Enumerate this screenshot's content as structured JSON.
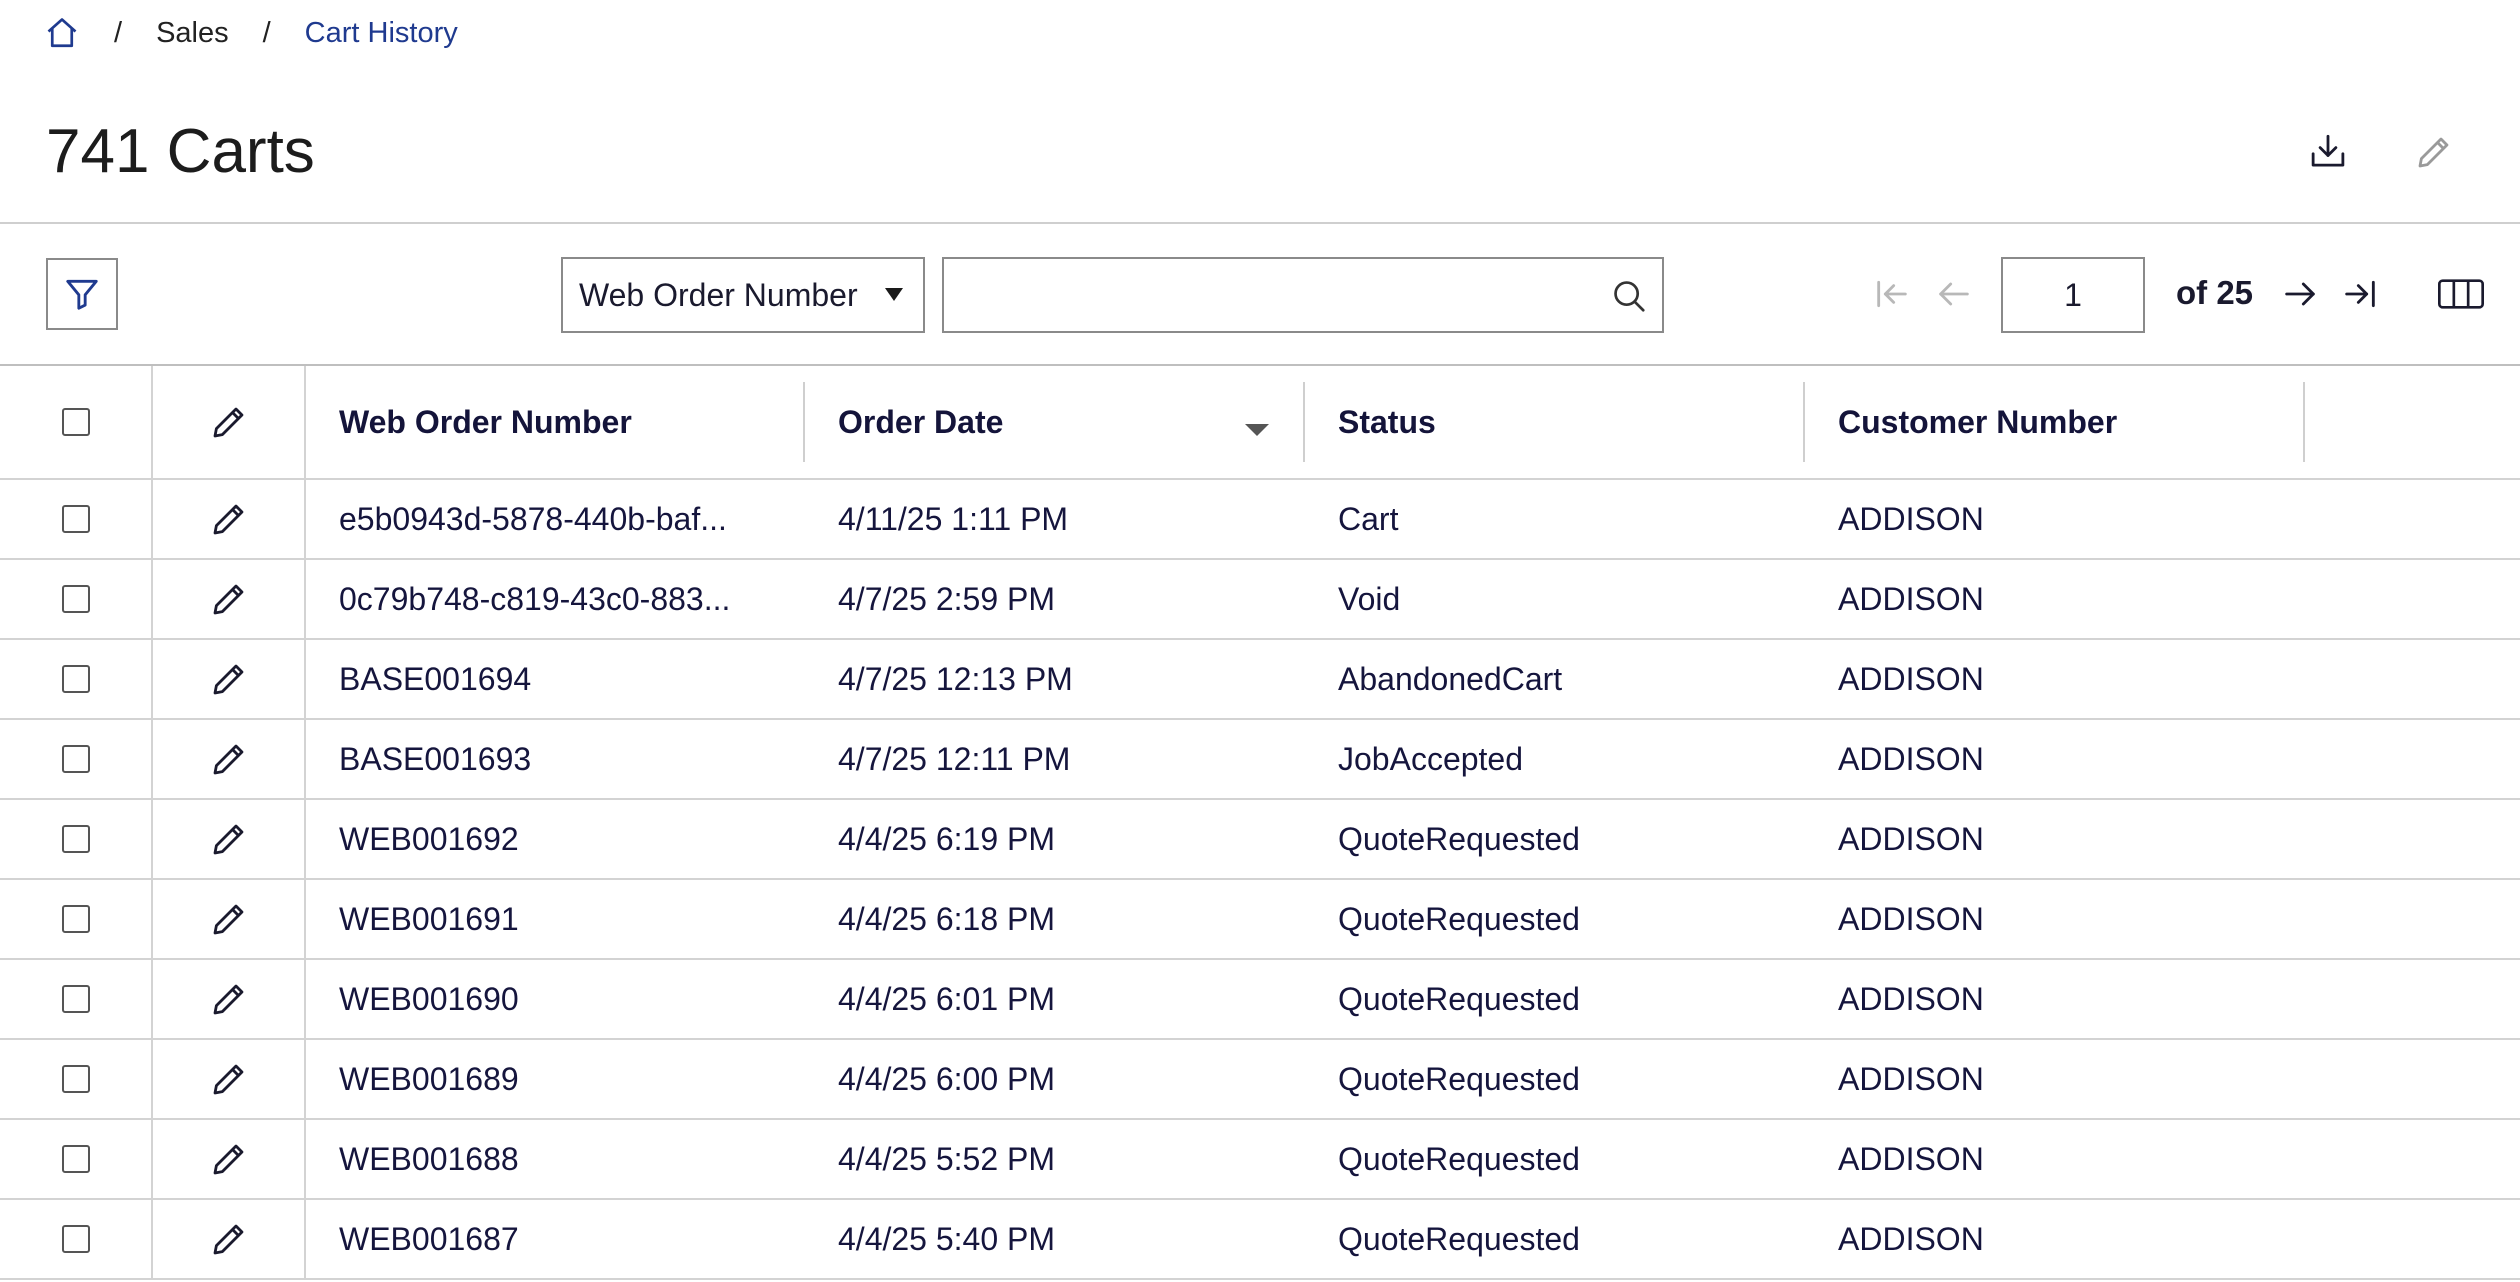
{
  "breadcrumb": {
    "home_icon": "home-icon",
    "separator": "/",
    "items": [
      {
        "label": "Sales"
      },
      {
        "label": "Cart History"
      }
    ]
  },
  "page": {
    "title": "741 Carts"
  },
  "header_actions": {
    "download_icon": "download-icon",
    "edit_icon": "edit-icon"
  },
  "toolbar": {
    "filter_icon": "filter-icon",
    "search_field_selected": "Web Order Number",
    "search_value": "",
    "search_icon": "search-icon",
    "pagination": {
      "current_page": "1",
      "of_label": "of",
      "total_pages": "25"
    }
  },
  "table": {
    "columns": [
      "Web Order Number",
      "Order Date",
      "Status",
      "Customer Number"
    ],
    "sort_column": "Order Date",
    "sort_direction": "descending",
    "rows": [
      {
        "web_order_number": "e5b0943d-5878-440b-baf...",
        "order_date": "4/11/25 1:11 PM",
        "status": "Cart",
        "customer_number": "ADDISON"
      },
      {
        "web_order_number": "0c79b748-c819-43c0-883...",
        "order_date": "4/7/25 2:59 PM",
        "status": "Void",
        "customer_number": "ADDISON"
      },
      {
        "web_order_number": "BASE001694",
        "order_date": "4/7/25 12:13 PM",
        "status": "AbandonedCart",
        "customer_number": "ADDISON"
      },
      {
        "web_order_number": "BASE001693",
        "order_date": "4/7/25 12:11 PM",
        "status": "JobAccepted",
        "customer_number": "ADDISON"
      },
      {
        "web_order_number": "WEB001692",
        "order_date": "4/4/25 6:19 PM",
        "status": "QuoteRequested",
        "customer_number": "ADDISON"
      },
      {
        "web_order_number": "WEB001691",
        "order_date": "4/4/25 6:18 PM",
        "status": "QuoteRequested",
        "customer_number": "ADDISON"
      },
      {
        "web_order_number": "WEB001690",
        "order_date": "4/4/25 6:01 PM",
        "status": "QuoteRequested",
        "customer_number": "ADDISON"
      },
      {
        "web_order_number": "WEB001689",
        "order_date": "4/4/25 6:00 PM",
        "status": "QuoteRequested",
        "customer_number": "ADDISON"
      },
      {
        "web_order_number": "WEB001688",
        "order_date": "4/4/25 5:52 PM",
        "status": "QuoteRequested",
        "customer_number": "ADDISON"
      },
      {
        "web_order_number": "WEB001687",
        "order_date": "4/4/25 5:40 PM",
        "status": "QuoteRequested",
        "customer_number": "ADDISON"
      }
    ]
  },
  "colors": {
    "accent": "#1f3a8f",
    "text": "#15153d",
    "border": "#d3d3d3"
  }
}
